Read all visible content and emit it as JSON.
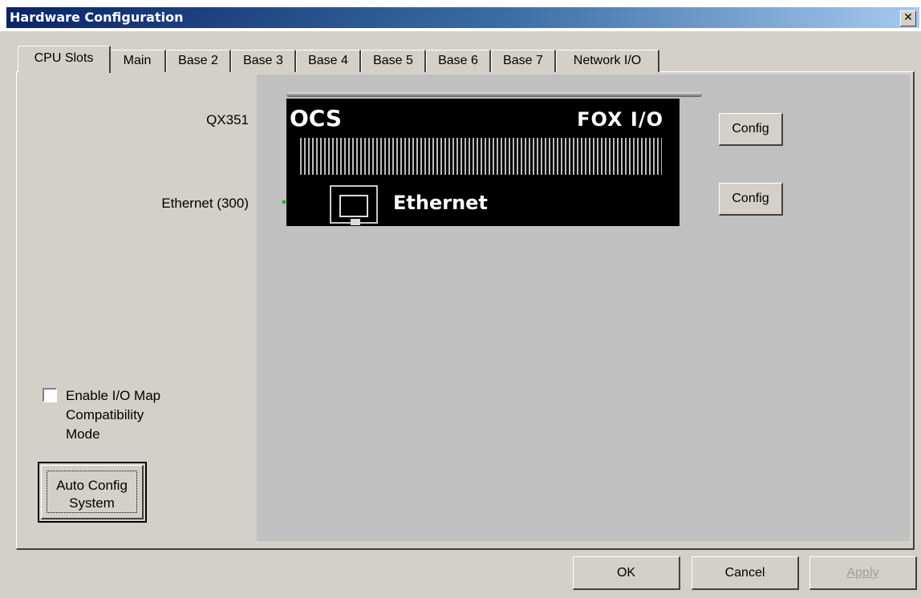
{
  "window": {
    "title": "Hardware Configuration",
    "close_glyph": "✕"
  },
  "tabs": [
    {
      "label": "CPU Slots",
      "active": true
    },
    {
      "label": "Main"
    },
    {
      "label": "Base 2"
    },
    {
      "label": "Base 3"
    },
    {
      "label": "Base 4"
    },
    {
      "label": "Base 5"
    },
    {
      "label": "Base 6"
    },
    {
      "label": "Base 7"
    },
    {
      "label": "Network I/O"
    }
  ],
  "slots": [
    {
      "label": "QX351",
      "config_label": "Config"
    },
    {
      "label": "Ethernet (300)",
      "config_label": "Config"
    }
  ],
  "module": {
    "brand": "OCS",
    "product": "FOX I/O",
    "port_label": "Ethernet"
  },
  "options": {
    "compat_label_line1": "Enable I/O Map",
    "compat_label_line2": "Compatibility",
    "compat_label_line3": "Mode",
    "compat_checked": false
  },
  "auto_config": {
    "line1": "Auto Config",
    "line2": "System"
  },
  "footer": {
    "ok": "OK",
    "cancel": "Cancel",
    "apply": "Apply"
  },
  "colors": {
    "titlebar_start": "#0a246a",
    "titlebar_end": "#a6caf0",
    "led": "#1fb01f"
  }
}
